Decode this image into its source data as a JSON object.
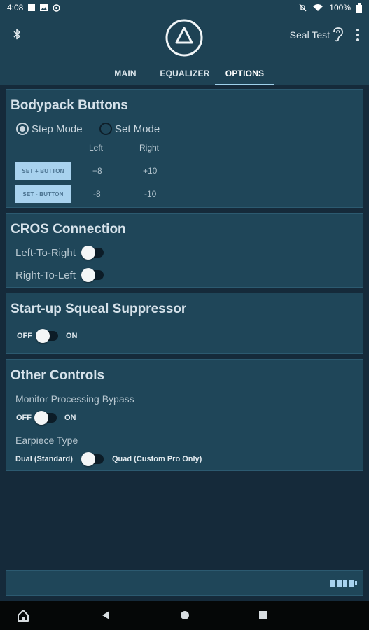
{
  "status_bar": {
    "time": "4:08",
    "battery_percent": "100%",
    "icons": [
      "sim-icon",
      "photo-icon",
      "settings-icon",
      "mute-icon",
      "wifi-icon",
      "battery-icon"
    ]
  },
  "header": {
    "device_name": "Seal Test",
    "icons": [
      "bluetooth-icon",
      "logo-icon",
      "ear-icon",
      "more-vert-icon"
    ],
    "tabs": [
      {
        "label": "MAIN",
        "active": false
      },
      {
        "label": "EQUALIZER",
        "active": false
      },
      {
        "label": "OPTIONS",
        "active": true
      }
    ]
  },
  "bodypack": {
    "title": "Bodypack Buttons",
    "modes": [
      {
        "label": "Step Mode",
        "selected": true
      },
      {
        "label": "Set Mode",
        "selected": false
      }
    ],
    "col_left": "Left",
    "col_right": "Right",
    "rows": [
      {
        "button": "SET + BUTTON",
        "left": "+8",
        "right": "+10"
      },
      {
        "button": "SET - BUTTON",
        "left": "-8",
        "right": "-10"
      }
    ]
  },
  "cros": {
    "title": "CROS Connection",
    "items": [
      {
        "label": "Left-To-Right",
        "on": false
      },
      {
        "label": "Right-To-Left",
        "on": false
      }
    ]
  },
  "squeal": {
    "title": "Start-up Squeal Suppressor",
    "off_label": "OFF",
    "on_label": "ON",
    "on": false
  },
  "other": {
    "title": "Other Controls",
    "bypass_label": "Monitor Processing Bypass",
    "bypass_off": "OFF",
    "bypass_on": "ON",
    "bypass_enabled": false,
    "earpiece_label": "Earpiece Type",
    "earpiece_left": "Dual (Standard)",
    "earpiece_right": "Quad (Custom Pro Only)",
    "earpiece_quad": false
  },
  "footer": {
    "battery_cells": 4,
    "battery_level": 1.0
  },
  "nav_bar": {
    "icons": [
      "home-icon",
      "back-icon",
      "home-circle-icon",
      "recents-icon"
    ]
  },
  "colors": {
    "background": "#152a3a",
    "header": "#1e4254",
    "card": "#1f4659",
    "accent": "#a8d2ee"
  }
}
